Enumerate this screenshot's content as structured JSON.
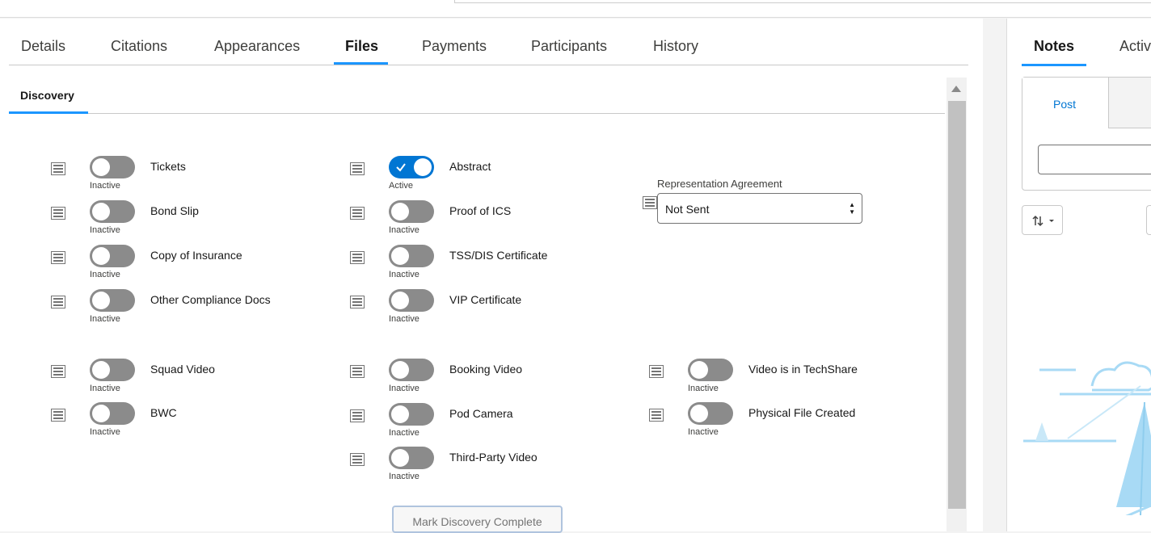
{
  "tabs": [
    {
      "label": "Details",
      "active": false
    },
    {
      "label": "Citations",
      "active": false
    },
    {
      "label": "Appearances",
      "active": false
    },
    {
      "label": "Files",
      "active": true
    },
    {
      "label": "Payments",
      "active": false
    },
    {
      "label": "Participants",
      "active": false
    },
    {
      "label": "History",
      "active": false
    }
  ],
  "subtab": {
    "label": "Discovery"
  },
  "discovery": {
    "group1_col1": [
      {
        "label": "Tickets",
        "state": "Inactive",
        "on": false
      },
      {
        "label": "Bond Slip",
        "state": "Inactive",
        "on": false
      },
      {
        "label": "Copy of Insurance",
        "state": "Inactive",
        "on": false
      },
      {
        "label": "Other Compliance Docs",
        "state": "Inactive",
        "on": false
      }
    ],
    "group1_col2": [
      {
        "label": "Abstract",
        "state": "Active",
        "on": true
      },
      {
        "label": "Proof of ICS",
        "state": "Inactive",
        "on": false
      },
      {
        "label": "TSS/DIS Certificate",
        "state": "Inactive",
        "on": false
      },
      {
        "label": "VIP Certificate",
        "state": "Inactive",
        "on": false
      }
    ],
    "group2_col1": [
      {
        "label": "Squad Video",
        "state": "Inactive",
        "on": false
      },
      {
        "label": "BWC",
        "state": "Inactive",
        "on": false
      }
    ],
    "group2_col2": [
      {
        "label": "Booking Video",
        "state": "Inactive",
        "on": false
      },
      {
        "label": "Pod Camera",
        "state": "Inactive",
        "on": false
      },
      {
        "label": "Third-Party Video",
        "state": "Inactive",
        "on": false
      }
    ],
    "group2_col3": [
      {
        "label": "Video is in TechShare",
        "state": "Inactive",
        "on": false
      },
      {
        "label": "Physical File Created",
        "state": "Inactive",
        "on": false
      }
    ],
    "representation": {
      "label": "Representation Agreement",
      "value": "Not Sent"
    },
    "mark_complete_label": "Mark Discovery Complete"
  },
  "right_panel": {
    "tabs": [
      {
        "label": "Notes",
        "active": true
      },
      {
        "label": "Activi",
        "active": false
      }
    ],
    "post_label": "Post"
  },
  "colors": {
    "accent": "#1b96ff",
    "toggle_on": "#0176d3",
    "toggle_off": "#8b8b8b"
  }
}
